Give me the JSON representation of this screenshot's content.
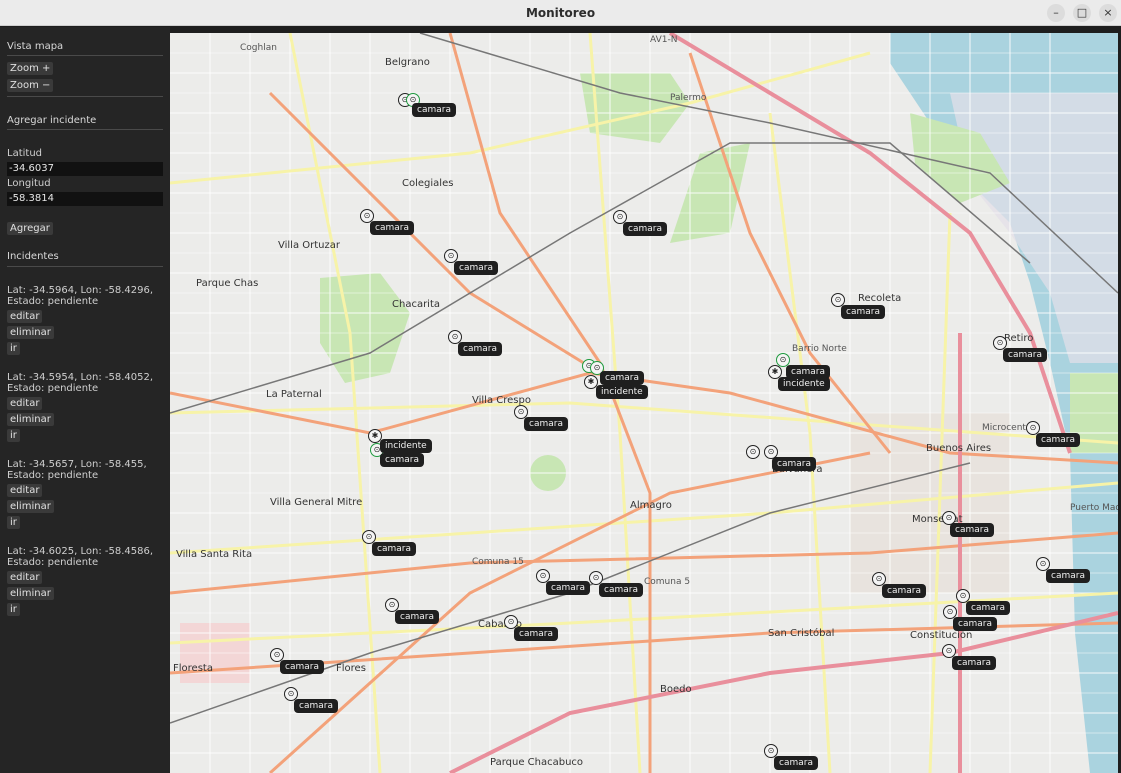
{
  "window": {
    "title": "Monitoreo",
    "minimize": "–",
    "maximize": "□",
    "close": "×"
  },
  "sidebar": {
    "map_view_heading": "Vista mapa",
    "zoom_in": "Zoom +",
    "zoom_out": "Zoom −",
    "add_incident_heading": "Agregar incidente",
    "lat_label": "Latitud",
    "lat_value": "-34.6037",
    "lon_label": "Longitud",
    "lon_value": "-58.3814",
    "add_button": "Agregar",
    "incidents_heading": "Incidentes",
    "incidents": [
      {
        "text": "Lat: -34.5964, Lon: -58.4296, Estado: pendiente",
        "edit": "editar",
        "delete": "eliminar",
        "go": "ir"
      },
      {
        "text": "Lat: -34.5954, Lon: -58.4052, Estado: pendiente",
        "edit": "editar",
        "delete": "eliminar",
        "go": "ir"
      },
      {
        "text": "Lat: -34.5657, Lon: -58.455, Estado: pendiente",
        "edit": "editar",
        "delete": "eliminar",
        "go": "ir"
      },
      {
        "text": "Lat: -34.6025, Lon: -58.4586, Estado: pendiente",
        "edit": "editar",
        "delete": "eliminar",
        "go": "ir"
      }
    ]
  },
  "map": {
    "marker_label_camera": "camara",
    "marker_label_incident": "incidente",
    "place_labels": [
      "Belgrano",
      "Coghlan",
      "Colegiales",
      "Villa Ortuzar",
      "Parque Chas",
      "Chacarita",
      "La Paternal",
      "Villa Crespo",
      "Villa General Mitre",
      "Villa Santa Rita",
      "Caballito",
      "Almagro",
      "Balvanera",
      "Recoleta",
      "Barrio Norte",
      "Retiro",
      "Buenos Aires",
      "Microcentro",
      "Monserrat",
      "San Cristóbal",
      "Boedo",
      "Constitución",
      "Parque Chacabuco",
      "Floresta",
      "Flores",
      "Puerto Madero",
      "Palermo",
      "AV1-N",
      "Comuna 5",
      "Comuna 15"
    ],
    "colors": {
      "water": "#aad3df",
      "park": "#c8e6b4",
      "primary_road": "#f3a27a",
      "secondary_road": "#f7f3a8",
      "motorway": "#e98f9c",
      "rail": "#777777"
    }
  }
}
